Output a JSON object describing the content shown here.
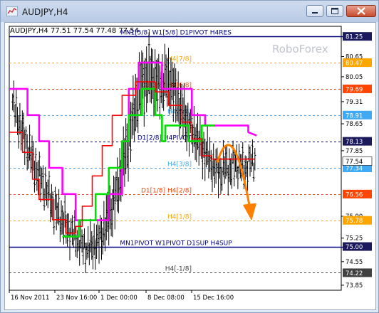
{
  "window": {
    "title": "AUDJPY,H4"
  },
  "header": {
    "symbol_line": "AUDJPY,H4  77.51 77.54 77.48 77.54"
  },
  "watermark": "RoboForex",
  "colors": {
    "black_line": "#000000",
    "magenta": "#ff00ff",
    "green": "#00e000",
    "red": "#ff0000",
    "navy": "#000080",
    "arrow": "#ff7f00",
    "orange_tag": "#ffa500",
    "red_tag": "#ff4500",
    "blue_tag": "#3fa9f5",
    "dark_tag": "#1a1a5c",
    "gray_tag": "#404040"
  },
  "levels": [
    {
      "price": 81.25,
      "tag": "81.25",
      "label": "MN1[5/8] W1[5/8] D1PIVOT H4RES",
      "style": "solid",
      "color": "#000080",
      "tag_color": "#1a1a5c",
      "label_color": "#000080",
      "label_pos": "center"
    },
    {
      "price": 80.47,
      "tag": "80.47",
      "label": "H4[7/8]",
      "style": "dashed",
      "color": "#ffa500",
      "tag_color": "#ffa500",
      "label_color": "#ffa500",
      "label_pos": "right"
    },
    {
      "price": 79.69,
      "tag": "79.69",
      "label": "D1[3/8] H4[6/8]",
      "style": "dashed",
      "color": "#ff4500",
      "tag_color": "#ff4500",
      "label_color": "#ff4500",
      "label_pos": "right"
    },
    {
      "price": 78.91,
      "tag": "78.91",
      "label": "H4[5/8]",
      "style": "dashed",
      "color": "#3fa9f5",
      "tag_color": "#3fa9f5",
      "label_color": "#3fa9f5",
      "label_pos": "right"
    },
    {
      "price": 78.13,
      "tag": "78.13",
      "label": "D1[2/8] H4PIVOT",
      "style": "dashed",
      "color": "#000080",
      "tag_color": "#1a1a5c",
      "label_color": "#000080",
      "label_pos": "right"
    },
    {
      "price": 77.34,
      "tag": "77.34",
      "label": "H4[3/8]",
      "style": "dashed",
      "color": "#3fa9f5",
      "tag_color": "#3fa9f5",
      "label_color": "#3fa9f5",
      "label_pos": "right"
    },
    {
      "price": 76.56,
      "tag": "76.56",
      "label": "D1[1/8] H4[2/8]",
      "style": "dashed",
      "color": "#ff4500",
      "tag_color": "#ff4500",
      "label_color": "#ff4500",
      "label_pos": "right"
    },
    {
      "price": 75.78,
      "tag": "75.78",
      "label": "H4[1/8]",
      "style": "dashed",
      "color": "#ffa500",
      "tag_color": "#ffa500",
      "label_color": "#ffa500",
      "label_pos": "right"
    },
    {
      "price": 75.0,
      "tag": "75.00",
      "label": "MN1PIVOT W1PIVOT D1SUP H4SUP",
      "style": "solid",
      "color": "#000080",
      "tag_color": "#1a1a5c",
      "label_color": "#000080",
      "label_pos": "center"
    },
    {
      "price": 74.22,
      "tag": "74.22",
      "label": "H4[-1/8]",
      "style": "dashed",
      "color": "#404040",
      "tag_color": "#404040",
      "label_color": "#404040",
      "label_pos": "right"
    }
  ],
  "current_price": {
    "price": 77.54,
    "tag": "77.54"
  },
  "y_ticks": [
    "80.65",
    "80.05",
    "79.31",
    "78.65",
    "77.85",
    "75.90",
    "75.25",
    "74.55",
    "73.85"
  ],
  "x_ticks": [
    "16 Nov 2011",
    "23 Nov 16:00",
    "1 Dec 00:00",
    "8 Dec 08:00",
    "15 Dec 16:00"
  ],
  "chart_data": {
    "type": "line",
    "title": "AUDJPY,H4",
    "xlabel": "",
    "ylabel": "",
    "ylim": [
      73.7,
      81.55
    ],
    "x_ticks": [
      "16 Nov 2011",
      "23 Nov 16:00",
      "1 Dec 00:00",
      "8 Dec 08:00",
      "15 Dec 16:00"
    ],
    "price_bars": {
      "mid": [
        79.3,
        78.8,
        78.4,
        77.95,
        77.6,
        77.2,
        76.9,
        76.6,
        76.3,
        76.0,
        75.8,
        75.55,
        75.4,
        75.2,
        75.05,
        74.95,
        75.0,
        75.1,
        75.35,
        75.7,
        76.1,
        76.6,
        77.2,
        77.9,
        78.6,
        79.3,
        79.8,
        80.0,
        80.1,
        79.9,
        79.8,
        80.0,
        79.9,
        79.5,
        79.1,
        78.8,
        78.5,
        78.3,
        78.0,
        77.8,
        77.5,
        77.3,
        77.2,
        77.4,
        77.3,
        77.5,
        77.4,
        77.3,
        77.5,
        77.6
      ],
      "range": [
        0.5,
        0.6,
        0.6,
        0.6,
        0.6,
        0.6,
        0.6,
        0.5,
        0.6,
        0.6,
        0.6,
        0.6,
        0.5,
        0.5,
        0.5,
        0.5,
        0.6,
        0.6,
        0.7,
        0.8,
        0.8,
        0.9,
        0.9,
        1.0,
        1.0,
        1.0,
        1.1,
        1.1,
        1.0,
        0.9,
        0.9,
        0.9,
        0.9,
        0.9,
        0.8,
        0.8,
        0.7,
        0.7,
        0.7,
        0.7,
        0.6,
        0.6,
        0.6,
        0.6,
        0.6,
        0.6,
        0.5,
        0.5,
        0.5,
        0.4
      ]
    },
    "magenta_line": [
      {
        "x": 0.0,
        "y": 79.69
      },
      {
        "x": 0.055,
        "y": 79.69
      },
      {
        "x": 0.055,
        "y": 78.91
      },
      {
        "x": 0.09,
        "y": 78.91
      },
      {
        "x": 0.09,
        "y": 78.13
      },
      {
        "x": 0.12,
        "y": 78.13
      },
      {
        "x": 0.12,
        "y": 77.34
      },
      {
        "x": 0.16,
        "y": 77.34
      },
      {
        "x": 0.16,
        "y": 76.56
      },
      {
        "x": 0.2,
        "y": 76.56
      },
      {
        "x": 0.2,
        "y": 75.78
      },
      {
        "x": 0.3,
        "y": 75.78
      },
      {
        "x": 0.3,
        "y": 76.56
      },
      {
        "x": 0.34,
        "y": 76.56
      },
      {
        "x": 0.34,
        "y": 78.13
      },
      {
        "x": 0.36,
        "y": 78.13
      },
      {
        "x": 0.36,
        "y": 79.69
      },
      {
        "x": 0.39,
        "y": 79.69
      },
      {
        "x": 0.39,
        "y": 80.47
      },
      {
        "x": 0.46,
        "y": 80.47
      },
      {
        "x": 0.46,
        "y": 79.69
      },
      {
        "x": 0.55,
        "y": 79.69
      },
      {
        "x": 0.55,
        "y": 78.91
      },
      {
        "x": 0.59,
        "y": 78.91
      },
      {
        "x": 0.59,
        "y": 78.6
      },
      {
        "x": 0.72,
        "y": 78.6
      },
      {
        "x": 0.72,
        "y": 78.4
      },
      {
        "x": 0.745,
        "y": 78.3
      }
    ],
    "green_line": [
      {
        "x": 0.16,
        "y": 75.3
      },
      {
        "x": 0.21,
        "y": 75.3
      },
      {
        "x": 0.21,
        "y": 75.78
      },
      {
        "x": 0.26,
        "y": 75.78
      },
      {
        "x": 0.26,
        "y": 76.56
      },
      {
        "x": 0.3,
        "y": 76.56
      },
      {
        "x": 0.3,
        "y": 77.34
      },
      {
        "x": 0.34,
        "y": 77.34
      },
      {
        "x": 0.34,
        "y": 78.13
      },
      {
        "x": 0.36,
        "y": 78.13
      },
      {
        "x": 0.36,
        "y": 78.91
      },
      {
        "x": 0.4,
        "y": 78.91
      },
      {
        "x": 0.4,
        "y": 79.69
      },
      {
        "x": 0.44,
        "y": 79.69
      },
      {
        "x": 0.44,
        "y": 78.91
      },
      {
        "x": 0.46,
        "y": 78.91
      },
      {
        "x": 0.46,
        "y": 78.13
      },
      {
        "x": 0.47,
        "y": 78.13
      },
      {
        "x": 0.47,
        "y": 78.6
      },
      {
        "x": 0.54,
        "y": 78.6
      },
      {
        "x": 0.54,
        "y": 78.13
      },
      {
        "x": 0.58,
        "y": 78.13
      },
      {
        "x": 0.58,
        "y": 78.6
      },
      {
        "x": 0.62,
        "y": 78.6
      }
    ],
    "red_line": [
      {
        "x": 0.0,
        "y": 78.4
      },
      {
        "x": 0.04,
        "y": 78.4
      },
      {
        "x": 0.04,
        "y": 77.8
      },
      {
        "x": 0.07,
        "y": 77.8
      },
      {
        "x": 0.07,
        "y": 77.0
      },
      {
        "x": 0.09,
        "y": 77.0
      },
      {
        "x": 0.09,
        "y": 76.4
      },
      {
        "x": 0.13,
        "y": 76.4
      },
      {
        "x": 0.13,
        "y": 75.8
      },
      {
        "x": 0.17,
        "y": 75.8
      },
      {
        "x": 0.17,
        "y": 75.4
      },
      {
        "x": 0.2,
        "y": 75.4
      },
      {
        "x": 0.2,
        "y": 75.6
      },
      {
        "x": 0.22,
        "y": 75.6
      },
      {
        "x": 0.22,
        "y": 76.2
      },
      {
        "x": 0.25,
        "y": 76.2
      },
      {
        "x": 0.25,
        "y": 77.1
      },
      {
        "x": 0.28,
        "y": 77.1
      },
      {
        "x": 0.28,
        "y": 78.0
      },
      {
        "x": 0.31,
        "y": 78.0
      },
      {
        "x": 0.31,
        "y": 78.9
      },
      {
        "x": 0.34,
        "y": 78.9
      },
      {
        "x": 0.34,
        "y": 79.5
      },
      {
        "x": 0.38,
        "y": 79.5
      },
      {
        "x": 0.38,
        "y": 79.9
      },
      {
        "x": 0.44,
        "y": 79.9
      },
      {
        "x": 0.44,
        "y": 79.6
      },
      {
        "x": 0.48,
        "y": 79.6
      },
      {
        "x": 0.48,
        "y": 79.2
      },
      {
        "x": 0.52,
        "y": 79.2
      },
      {
        "x": 0.52,
        "y": 78.7
      },
      {
        "x": 0.55,
        "y": 78.7
      },
      {
        "x": 0.55,
        "y": 78.2
      },
      {
        "x": 0.58,
        "y": 78.2
      },
      {
        "x": 0.58,
        "y": 77.7
      },
      {
        "x": 0.61,
        "y": 77.7
      },
      {
        "x": 0.61,
        "y": 77.6
      },
      {
        "x": 0.74,
        "y": 77.6
      }
    ]
  }
}
